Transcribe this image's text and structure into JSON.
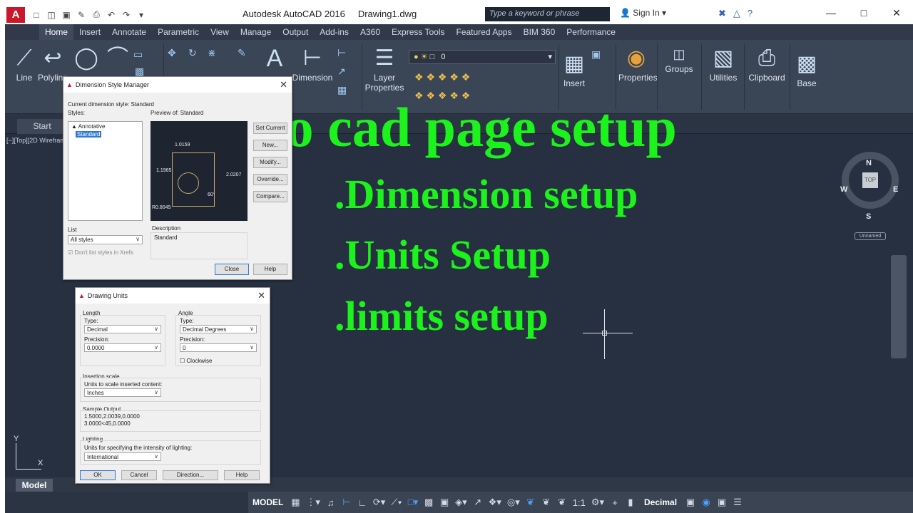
{
  "app": {
    "logo": "A",
    "title": "Autodesk AutoCAD 2016",
    "filename": "Drawing1.dwg",
    "search_placeholder": "Type a keyword or phrase",
    "signin": "Sign In",
    "accent_color": "#c8192a"
  },
  "ribbon_tabs": [
    "Home",
    "Insert",
    "Annotate",
    "Parametric",
    "View",
    "Manage",
    "Output",
    "Add-ins",
    "A360",
    "Express Tools",
    "Featured Apps",
    "BIM 360",
    "Performance"
  ],
  "active_tab": "Home",
  "ribbon": {
    "line": "Line",
    "polyline": "Polyline",
    "dimension": "Dimension",
    "layer_properties_1": "Layer",
    "layer_properties_2": "Properties",
    "layer_current": "0",
    "insert": "Insert",
    "properties": "Properties",
    "groups": "Groups",
    "utilities": "Utilities",
    "clipboard": "Clipboard",
    "base": "Base",
    "text_icon": "A"
  },
  "file_tabs": {
    "start": "Start"
  },
  "viewport": {
    "label": "[−][Top][2D Wireframe]",
    "viewcube_face": "TOP",
    "north": "N",
    "south": "S",
    "east": "E",
    "west": "W",
    "wcs": "Unnamed"
  },
  "overlay": {
    "title": "Auto cad page setup",
    "items": [
      ".Dimension setup",
      ".Units Setup",
      ".limits setup"
    ]
  },
  "ucs": {
    "y": "Y",
    "x": "X"
  },
  "layout_tabs": {
    "model": "Model"
  },
  "statusbar": {
    "model": "MODEL",
    "scale": "1:1",
    "units": "Decimal"
  },
  "dim_dialog": {
    "title": "Dimension Style Manager",
    "current_style_label": "Current dimension style: Standard",
    "styles_label": "Styles:",
    "styles": [
      "Annotative",
      "Standard"
    ],
    "selected_style": "Standard",
    "preview_label": "Preview of: Standard",
    "preview_values": {
      "top": "1.0159",
      "left": "1.1965",
      "right": "2.0207",
      "angle": "60°",
      "radius": "R0.8045"
    },
    "list_label": "List",
    "list_value": "All styles",
    "xrefs_label": "Don't list styles in Xrefs",
    "description_label": "Description",
    "description_value": "Standard",
    "buttons": {
      "set_current": "Set Current",
      "new": "New...",
      "modify": "Modify...",
      "override": "Override...",
      "compare": "Compare...",
      "close": "Close",
      "help": "Help"
    }
  },
  "units_dialog": {
    "title": "Drawing Units",
    "length_label": "Length",
    "type_label": "Type:",
    "length_type": "Decimal",
    "precision_label": "Precision:",
    "length_precision": "0.0000",
    "angle_label": "Angle",
    "angle_type_label": "Type:",
    "angle_type": "Decimal Degrees",
    "angle_precision_label": "Precision:",
    "angle_precision": "0",
    "clockwise_label": "Clockwise",
    "insertion_label": "Insertion scale",
    "insertion_sub": "Units to scale inserted content:",
    "insertion_value": "Inches",
    "sample_label": "Sample Output",
    "sample_line1": "1.5000,2.0039,0.0000",
    "sample_line2": "3.0000<45,0.0000",
    "lighting_label": "Lighting",
    "lighting_sub": "Units for specifying the intensity of lighting:",
    "lighting_value": "International",
    "buttons": {
      "ok": "OK",
      "cancel": "Cancel",
      "direction": "Direction...",
      "help": "Help"
    }
  }
}
